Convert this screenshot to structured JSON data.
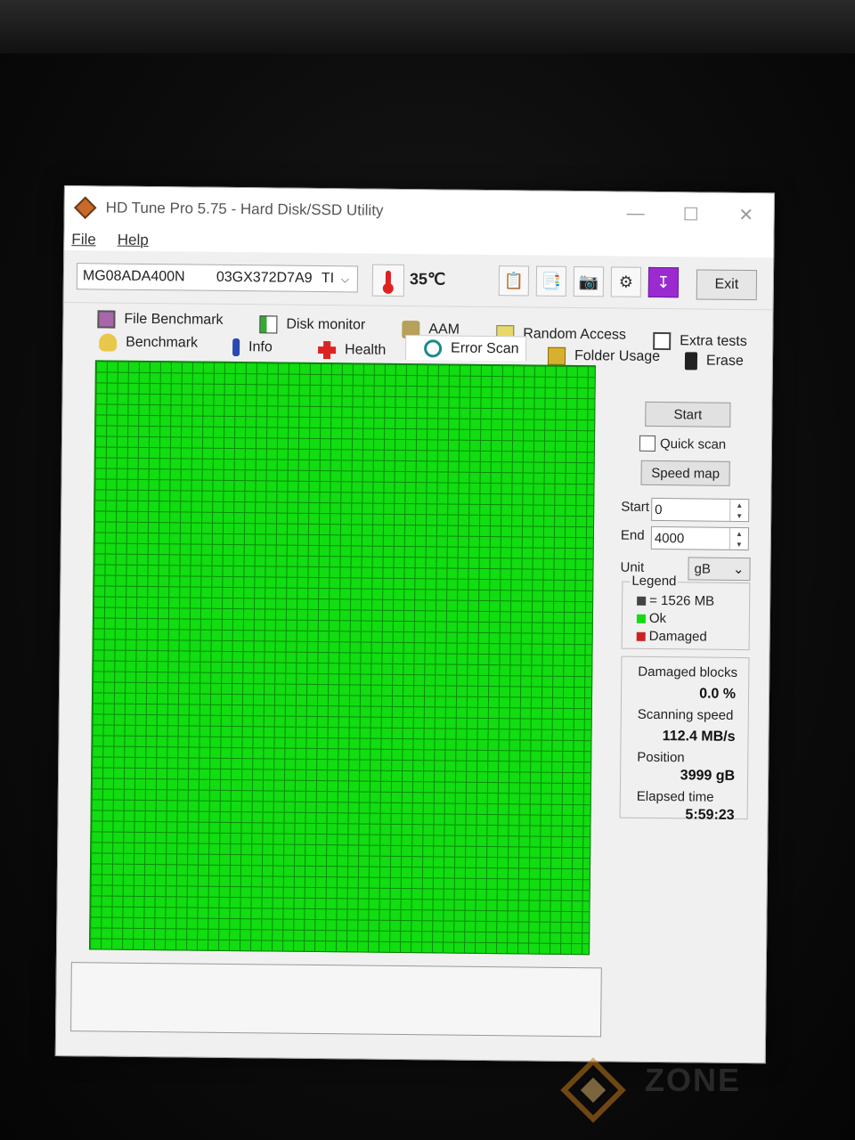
{
  "window": {
    "title": "HD Tune Pro 5.75 - Hard Disk/SSD Utility",
    "controls": {
      "minimize": "—",
      "maximize": "☐",
      "close": "✕"
    }
  },
  "menu": {
    "file": "File",
    "help": "Help"
  },
  "toolbar": {
    "drive_model": "MG08ADA400N",
    "drive_serial": "03GX372D7A9",
    "drive_suffix": "TI",
    "temperature": "35℃",
    "exit_label": "Exit",
    "icons": [
      "thermometer-icon",
      "copy-text-icon",
      "copy-screenshot-icon",
      "camera-icon",
      "options-icon",
      "save-download-icon"
    ]
  },
  "tabs": {
    "row1": [
      "File Benchmark",
      "Disk monitor",
      "AAM",
      "Random Access",
      "Extra tests"
    ],
    "row2": [
      "Benchmark",
      "Info",
      "Health",
      "Error Scan",
      "Folder Usage",
      "Erase"
    ],
    "active": "Error Scan"
  },
  "scan": {
    "start_button": "Start",
    "quick_scan_label": "Quick scan",
    "quick_scan_checked": false,
    "speed_map_button": "Speed map",
    "start_label": "Start",
    "start_value": "0",
    "end_label": "End",
    "end_value": "4000",
    "unit_label": "Unit",
    "unit_value": "gB"
  },
  "legend": {
    "title": "Legend",
    "block_size": "= 1526 MB",
    "ok": "Ok",
    "damaged": "Damaged",
    "colors": {
      "block": "#444444",
      "ok": "#11dd11",
      "damaged": "#cc2222"
    }
  },
  "stats": {
    "damaged_blocks_label": "Damaged blocks",
    "damaged_blocks_value": "0.0 %",
    "scanning_speed_label": "Scanning speed",
    "scanning_speed_value": "112.4 MB/s",
    "position_label": "Position",
    "position_value": "3999 gB",
    "elapsed_label": "Elapsed time",
    "elapsed_value": "5:59:23"
  },
  "watermark": {
    "text": "ZONE"
  }
}
